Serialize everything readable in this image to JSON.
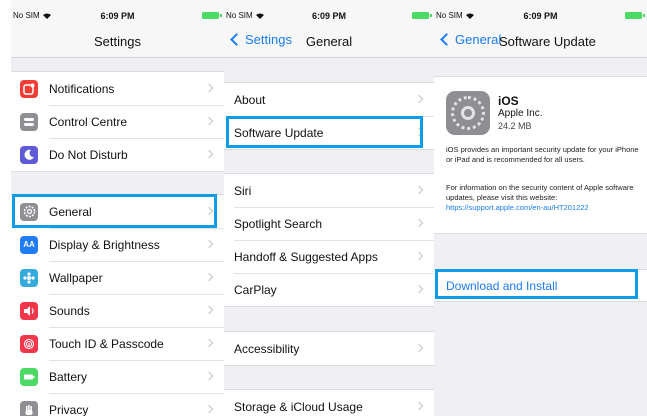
{
  "status": {
    "carrier": "No SIM",
    "time": "6:09 PM"
  },
  "settings": {
    "title": "Settings",
    "group1": [
      {
        "label": "Notifications",
        "icon": "notifications-icon",
        "color": "#f23c36"
      },
      {
        "label": "Control Centre",
        "icon": "control-centre-icon",
        "color": "#8e8e93"
      },
      {
        "label": "Do Not Disturb",
        "icon": "moon-icon",
        "color": "#5f5bd6"
      }
    ],
    "group2": [
      {
        "label": "General",
        "icon": "gear-icon",
        "color": "#8e8e93"
      },
      {
        "label": "Display & Brightness",
        "icon": "display-icon",
        "color": "#1f7cf2"
      },
      {
        "label": "Wallpaper",
        "icon": "wallpaper-icon",
        "color": "#35aadc"
      },
      {
        "label": "Sounds",
        "icon": "sounds-icon",
        "color": "#f2374b"
      },
      {
        "label": "Touch ID & Passcode",
        "icon": "fingerprint-icon",
        "color": "#f2374b"
      },
      {
        "label": "Battery",
        "icon": "battery-icon",
        "color": "#4cd964"
      },
      {
        "label": "Privacy",
        "icon": "hand-icon",
        "color": "#8e8e93"
      }
    ]
  },
  "general": {
    "back": "Settings",
    "title": "General",
    "group1": [
      "About",
      "Software Update"
    ],
    "group2": [
      "Siri",
      "Spotlight Search",
      "Handoff & Suggested Apps",
      "CarPlay"
    ],
    "group3": [
      "Accessibility"
    ],
    "group4": [
      "Storage & iCloud Usage"
    ]
  },
  "software_update": {
    "back": "General",
    "title": "Software Update",
    "name": "iOS",
    "vendor": "Apple Inc.",
    "size": "24.2 MB",
    "description": "iOS provides an important security update for your iPhone or iPad and is recommended for all users.",
    "info": "For information on the security content of Apple software updates, please visit this website:",
    "link": "https://support.apple.com/en-au/HT201222",
    "download": "Download and Install"
  },
  "colors": {
    "accent": "#1a7cf2",
    "highlight": "#0e9de6",
    "battery": "#4cd964"
  }
}
